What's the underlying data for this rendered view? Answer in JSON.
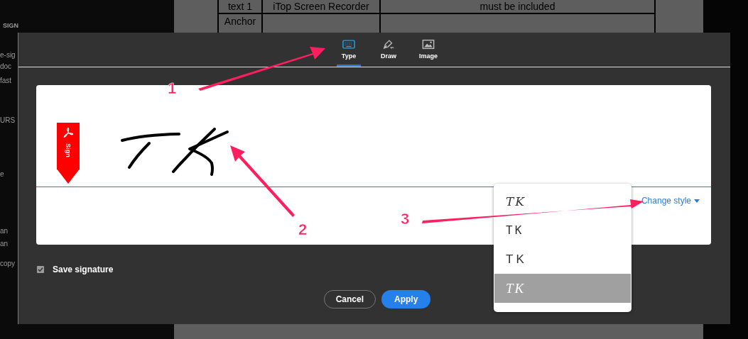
{
  "sidebar_fragments": [
    "SIGN",
    "e-sig",
    "doc",
    "fast",
    "URS",
    "e",
    "an",
    "an",
    "copy"
  ],
  "document_table": {
    "rows": [
      [
        "text 1",
        "iTop Screen Recorder",
        "must be included"
      ],
      [
        "Anchor",
        "",
        ""
      ]
    ]
  },
  "dialog": {
    "tabs": [
      {
        "label": "Type",
        "selected": true
      },
      {
        "label": "Draw",
        "selected": false
      },
      {
        "label": "Image",
        "selected": false
      }
    ],
    "sign_flag": "Sign",
    "change_style": "Change style",
    "save_signature": {
      "label": "Save signature",
      "checked": true
    },
    "buttons": [
      {
        "label": "Cancel",
        "kind": "secondary"
      },
      {
        "label": "Apply",
        "kind": "primary"
      }
    ]
  },
  "style_menu": {
    "options": [
      {
        "text": "TK",
        "kind": "italic",
        "selected": false
      },
      {
        "text": "TK",
        "kind": "spaced",
        "selected": false
      },
      {
        "text": "TK",
        "kind": "plain",
        "selected": false
      },
      {
        "text": "TK",
        "kind": "slanted",
        "selected": true
      }
    ]
  },
  "annotations": [
    {
      "number": "1"
    },
    {
      "number": "2"
    },
    {
      "number": "3"
    }
  ]
}
